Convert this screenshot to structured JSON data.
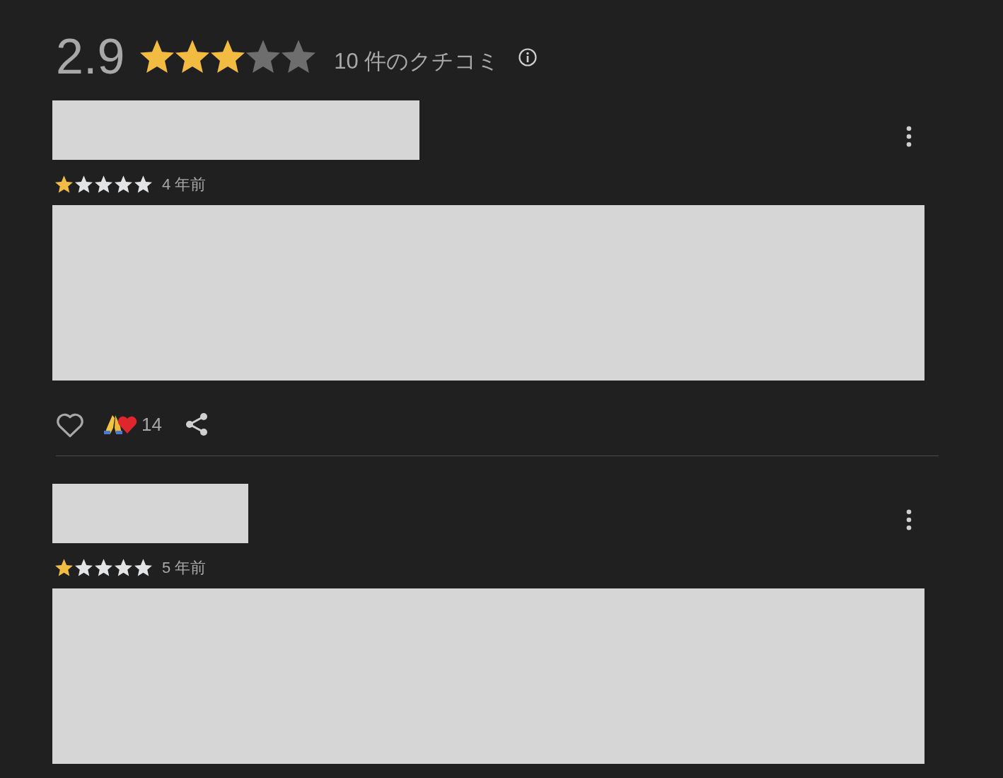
{
  "summary": {
    "rating": "2.9",
    "stars": 3,
    "count": "10 件のクチコミ"
  },
  "reviews": [
    {
      "stars": 1,
      "time": "4 年前",
      "actions": {
        "reaction_count": "14"
      }
    },
    {
      "stars": 1,
      "time": "5 年前"
    }
  ]
}
